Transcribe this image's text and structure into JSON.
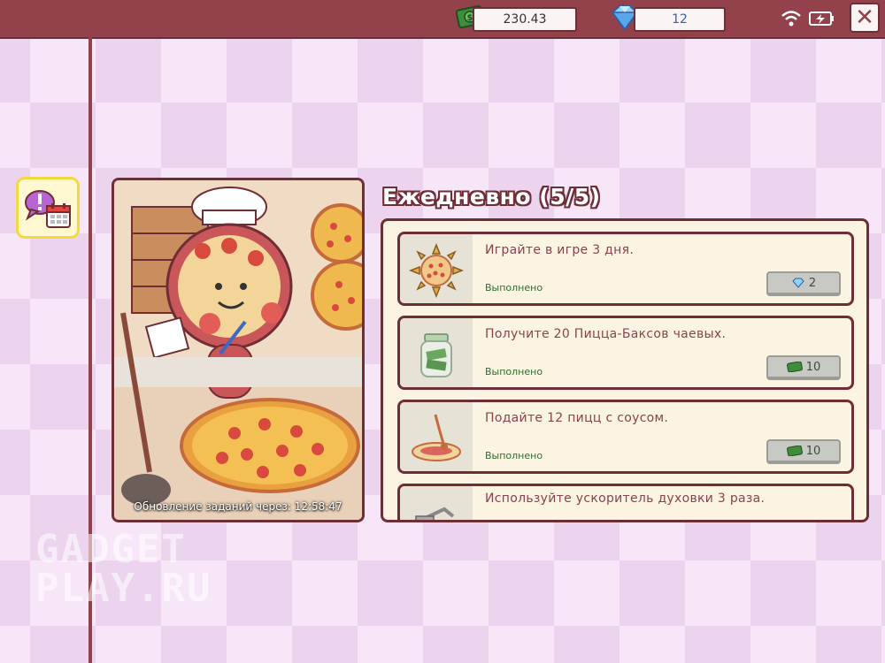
{
  "header": {
    "cash": "230.43",
    "gems": "12"
  },
  "art_panel": {
    "refresh_label": "Обновление заданий через: 12:58:47"
  },
  "daily": {
    "title": "Ежедневно (5/5)",
    "tasks": [
      {
        "title": "Играйте в игре 3 дня.",
        "status": "Выполнено",
        "reward": "2",
        "reward_type": "gem-icon",
        "icon": "sun-pizza-icon"
      },
      {
        "title": "Получите 20 Пицца-Баксов чаевых.",
        "status": "Выполнено",
        "reward": "10",
        "reward_type": "cash-icon",
        "icon": "tip-jar-icon"
      },
      {
        "title": "Подайте 12 пицц с соусом.",
        "status": "Выполнено",
        "reward": "10",
        "reward_type": "cash-icon",
        "icon": "sauce-ladle-icon"
      },
      {
        "title": "Используйте ускоритель духовки 3 раза.",
        "status": "",
        "reward": "",
        "reward_type": "",
        "icon": "oven-booster-icon"
      }
    ]
  },
  "watermark": {
    "line1": "GADGET",
    "line2": "PLAY.RU"
  },
  "colors": {
    "bar": "#93424b",
    "border": "#6f2d35",
    "status": "#2d6e2a",
    "task_text": "#8a4250"
  }
}
